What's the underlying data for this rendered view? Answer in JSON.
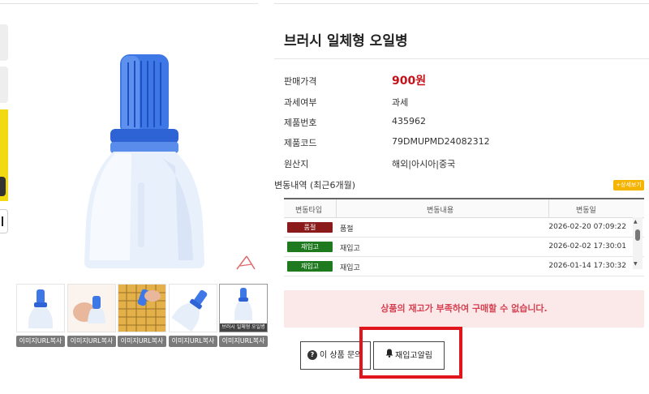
{
  "product": {
    "title": "브러시 일체형 오일병",
    "price_label": "판매가격",
    "price": "900원",
    "tax_label": "과세여부",
    "tax_value": "과세",
    "number_label": "제품번호",
    "number_value": "435962",
    "code_label": "제품코드",
    "code_value": "79DMUPMD24082312",
    "origin_label": "원산지",
    "origin_value": "해외|아시아|중국"
  },
  "history": {
    "label": "변동내역 (최근6개월)",
    "more_label": "+상세보기",
    "columns": [
      "변동타입",
      "변동내용",
      "변동일"
    ],
    "rows": [
      {
        "type": "품절",
        "type_color": "#8b1a1a",
        "content": "품절",
        "date": "2026-02-20 07:09:22"
      },
      {
        "type": "재입고",
        "type_color": "#1f7a1f",
        "content": "재입고",
        "date": "2026-02-02 17:30:01"
      },
      {
        "type": "재입고",
        "type_color": "#1f7a1f",
        "content": "재입고",
        "date": "2026-01-14 17:30:32"
      }
    ]
  },
  "alert": {
    "message": "상품의 재고가 부족하여 구매할 수 없습니다."
  },
  "buttons": {
    "inquiry_label": "이 상품 문의",
    "restock_label": "재입고알림"
  },
  "thumbnails": {
    "copy_label": "이미지URL복사",
    "caption_5": "브러시 일체형 오일병",
    "count": 5
  },
  "colors": {
    "price": "#c4121a",
    "alert_bg": "#fbe9ea",
    "alert_text": "#d64050",
    "highlight_border": "#e0161c",
    "more_btn": "#f4b400"
  },
  "icons": {
    "inquiry": "question-circle-icon",
    "restock": "bell-icon"
  }
}
